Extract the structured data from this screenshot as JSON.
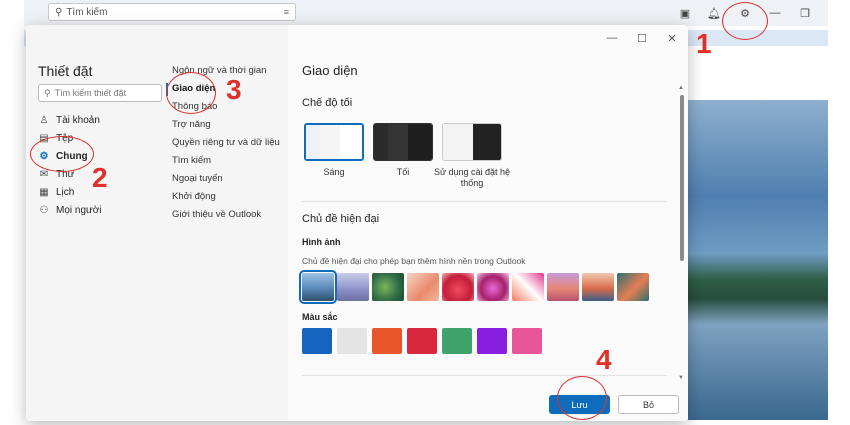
{
  "topbar": {
    "search_placeholder": "Tìm kiếm",
    "icons": [
      "filter-icon",
      "meeting-icon",
      "bell-icon",
      "gear-icon",
      "minimize-icon",
      "restore-icon"
    ]
  },
  "dialog": {
    "controls": {
      "minimize": "—",
      "maximize": "☐",
      "close": "✕"
    },
    "left": {
      "title": "Thiết đặt",
      "search_placeholder": "Tìm kiếm thiết đặt",
      "categories": [
        {
          "label": "Tài khoản",
          "icon": "person-icon"
        },
        {
          "label": "Tệp",
          "icon": "file-icon"
        },
        {
          "label": "Chung",
          "icon": "gear-icon",
          "active": true
        },
        {
          "label": "Thư",
          "icon": "mail-icon"
        },
        {
          "label": "Lịch",
          "icon": "calendar-icon"
        },
        {
          "label": "Mọi người",
          "icon": "people-icon"
        }
      ],
      "subcategories": [
        {
          "label": "Ngôn ngữ và thời gian"
        },
        {
          "label": "Giao diện",
          "active": true
        },
        {
          "label": "Thông báo"
        },
        {
          "label": "Trợ năng"
        },
        {
          "label": "Quyền riêng tư và dữ liệu"
        },
        {
          "label": "Tìm kiếm"
        },
        {
          "label": "Ngoại tuyến"
        },
        {
          "label": "Khởi động"
        },
        {
          "label": "Giới thiệu về Outlook"
        }
      ]
    },
    "right": {
      "title": "Giao diện",
      "dark_mode_title": "Chế độ tối",
      "themes": [
        {
          "label": "Sáng",
          "selected": true
        },
        {
          "label": "Tối"
        },
        {
          "label": "Sử dụng cài đặt hệ thống"
        }
      ],
      "modern_title": "Chủ đề hiện đại",
      "image_title": "Hình ảnh",
      "image_desc": "Chủ đề hiện đại cho phép bạn thêm hình nền trong Outlook",
      "color_title": "Màu sắc",
      "colors": [
        "#1565c0",
        "#e3e3e3",
        "#e8572c",
        "#d8283f",
        "#3fa36b",
        "#8a1ee0",
        "#e8559b"
      ]
    },
    "buttons": {
      "save": "Lưu",
      "cancel": "Bỏ"
    }
  },
  "annotations": [
    "1",
    "2",
    "3",
    "4"
  ]
}
